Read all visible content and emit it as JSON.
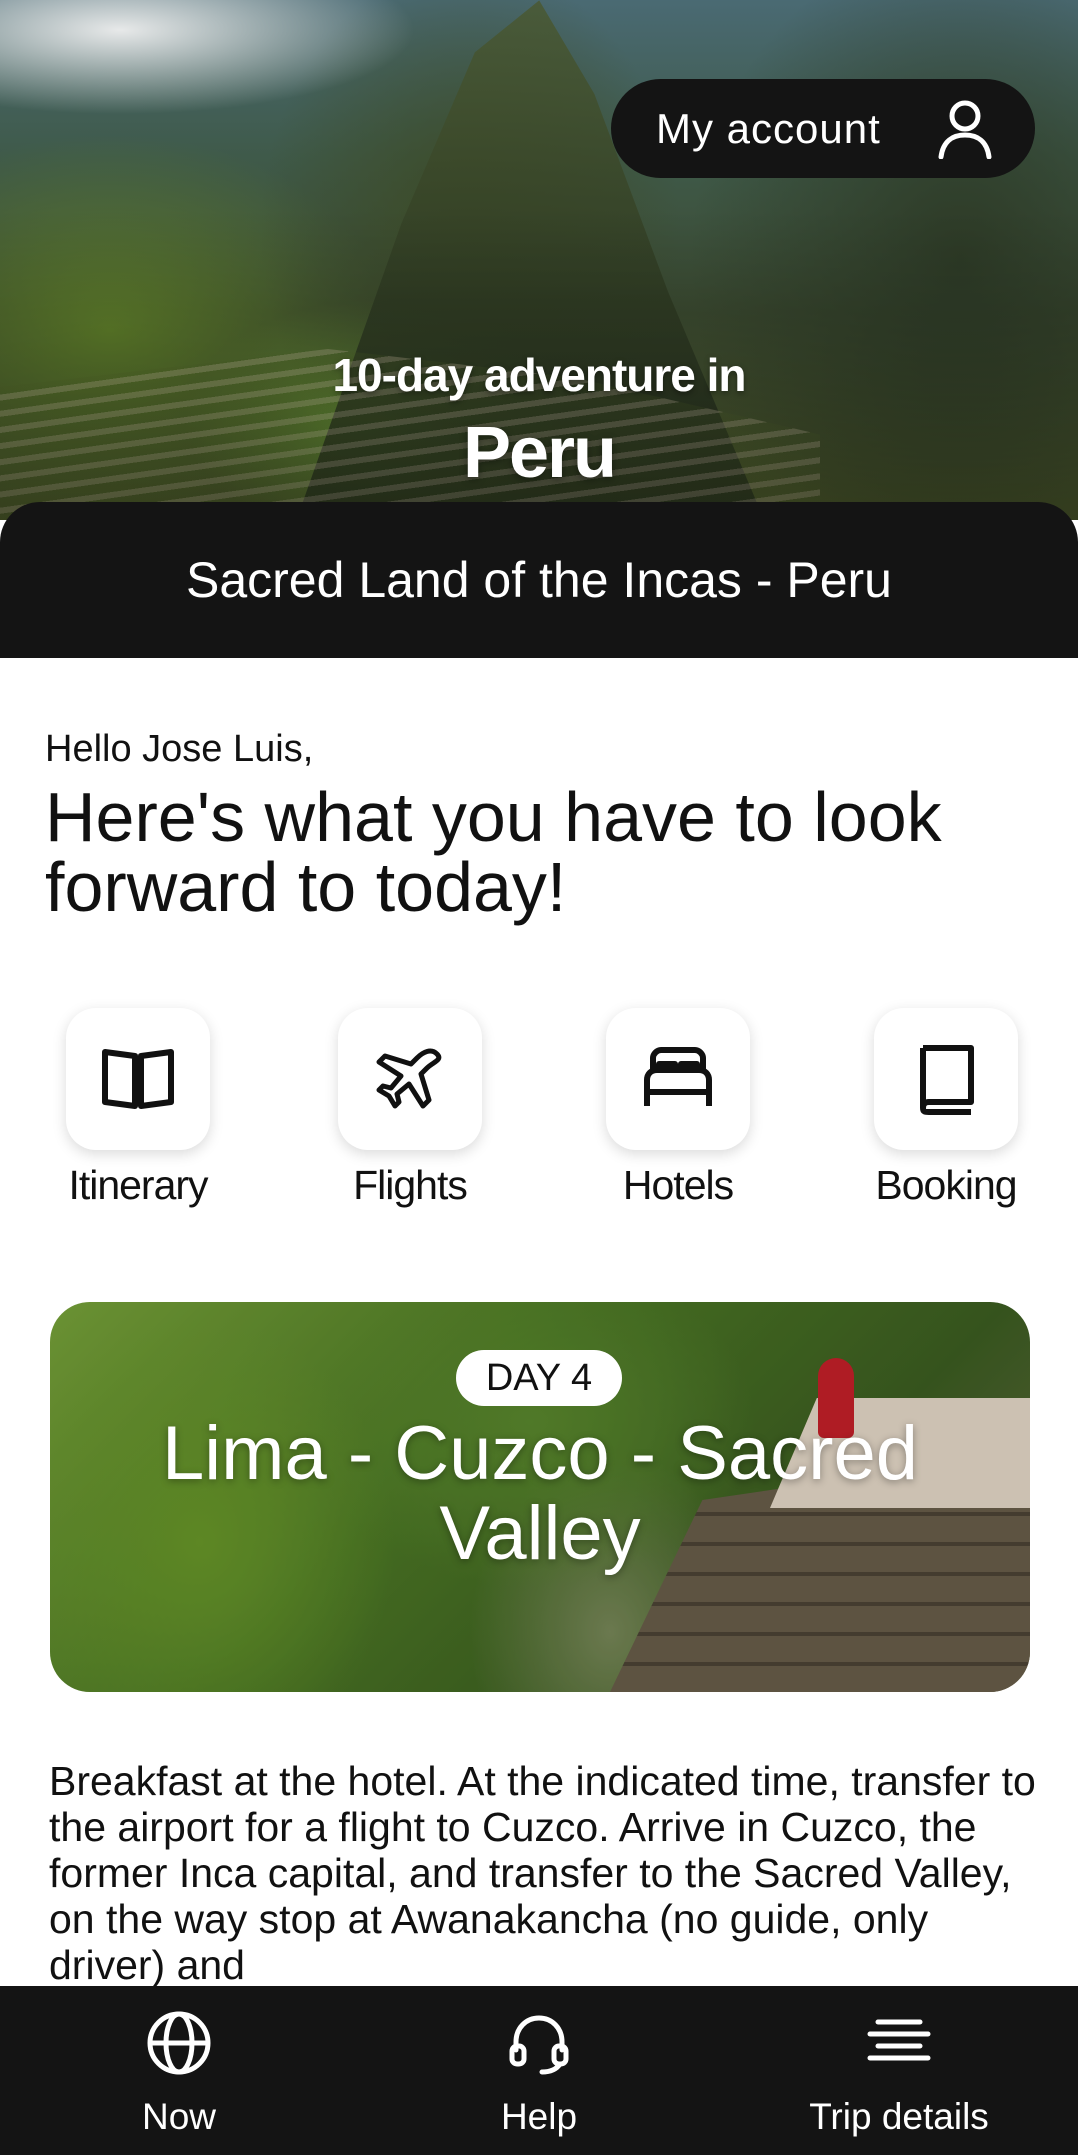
{
  "header": {
    "account_label": "My account",
    "subtitle": "10-day adventure in",
    "destination": "Peru"
  },
  "trip": {
    "name": "Sacred Land of the Incas - Peru"
  },
  "greeting": {
    "hello": "Hello Jose Luis,",
    "headline": "Here's what you have to look forward to today!"
  },
  "quick_links": [
    {
      "label": "Itinerary",
      "icon": "book-open-icon"
    },
    {
      "label": "Flights",
      "icon": "airplane-icon"
    },
    {
      "label": "Hotels",
      "icon": "bed-icon"
    },
    {
      "label": "Booking",
      "icon": "book-icon"
    }
  ],
  "day_card": {
    "badge": "DAY 4",
    "title": "Lima - Cuzco - Sacred Valley"
  },
  "description": "Breakfast at the hotel. At the indicated time, transfer to the airport for a flight to Cuzco. Arrive in Cuzco, the former Inca capital, and transfer to the Sacred Valley, on the way stop at Awanakancha (no guide, only driver) and",
  "bottom_nav": [
    {
      "label": "Now",
      "icon": "globe-icon"
    },
    {
      "label": "Help",
      "icon": "headset-icon"
    },
    {
      "label": "Trip details",
      "icon": "menu-lines-icon"
    }
  ],
  "colors": {
    "dark_bar": "#141414",
    "text": "#111111",
    "background": "#ffffff"
  }
}
